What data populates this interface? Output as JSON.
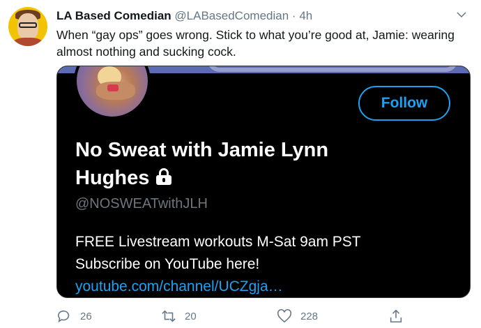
{
  "tweet": {
    "author_name": "LA Based Comedian",
    "author_handle": "@LABasedComedian",
    "separator": "·",
    "time": "4h",
    "text": "When “gay ops” goes wrong. Stick to what you’re good at, Jamie: wearing almost nothing and sucking cock."
  },
  "card": {
    "follow_label": "Follow",
    "display_name": "No Sweat with Jamie Lynn Hughes",
    "handle": "@NOSWEATwithJLH",
    "bio_line1": "FREE Livestream workouts M-Sat 9am PST",
    "bio_line2": "Subscribe on YouTube here!",
    "bio_link": "youtube.com/channel/UCZgja…"
  },
  "actions": {
    "reply_count": "26",
    "retweet_count": "20",
    "like_count": "228"
  },
  "icons": {
    "reply": "reply-icon",
    "retweet": "retweet-icon",
    "like": "heart-icon",
    "share": "share-icon",
    "lock": "lock-icon",
    "menu": "chevron-down-icon"
  },
  "colors": {
    "accent": "#1da1f2",
    "card_background": "#000000",
    "muted": "#657786"
  }
}
